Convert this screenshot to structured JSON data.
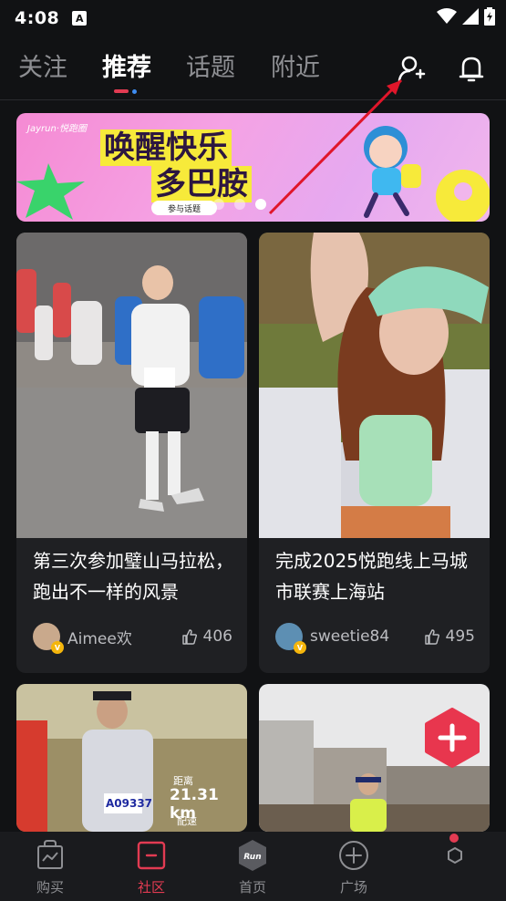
{
  "status_bar": {
    "time": "4:08",
    "notification_glyph": "A"
  },
  "top_nav": {
    "tabs": [
      {
        "label": "关注",
        "active": false
      },
      {
        "label": "推荐",
        "active": true
      },
      {
        "label": "话题",
        "active": false
      },
      {
        "label": "附近",
        "active": false
      }
    ],
    "icons": [
      "add-friend-icon",
      "bell-icon"
    ]
  },
  "banner": {
    "brand": "Jayrun·悦跑圈",
    "title_line1": "唤醒快乐",
    "title_line2": "多巴胺",
    "pill": "参与话题",
    "page_count": 3,
    "active_page": 2
  },
  "feed": [
    {
      "title": "第三次参加璧山马拉松，跑出不一样的风景",
      "author": "Aimee欢",
      "likes": "406"
    },
    {
      "title": "完成2025悦跑线上马城市联赛上海站",
      "author": "sweetie84",
      "likes": "495"
    },
    {
      "overlay_distance_label": "距离",
      "overlay_distance": "21.31 km",
      "overlay_pace_label": "配速",
      "bib": "A09337"
    },
    {}
  ],
  "bottom_nav": {
    "items": [
      {
        "label": "购买",
        "icon": "shopping-bag-icon",
        "active": false
      },
      {
        "label": "社区",
        "icon": "community-icon",
        "active": true
      },
      {
        "label": "首页",
        "icon": "run-logo-icon",
        "active": false
      },
      {
        "label": "广场",
        "icon": "plus-circle-icon",
        "active": false
      },
      {
        "label": "",
        "icon": "profile-icon",
        "active": false
      }
    ],
    "center_logo_text": "Run"
  },
  "colors": {
    "accent": "#e23b52",
    "background": "#111214",
    "card": "#1f2023",
    "indicator_dot": "#3e8cf0"
  }
}
